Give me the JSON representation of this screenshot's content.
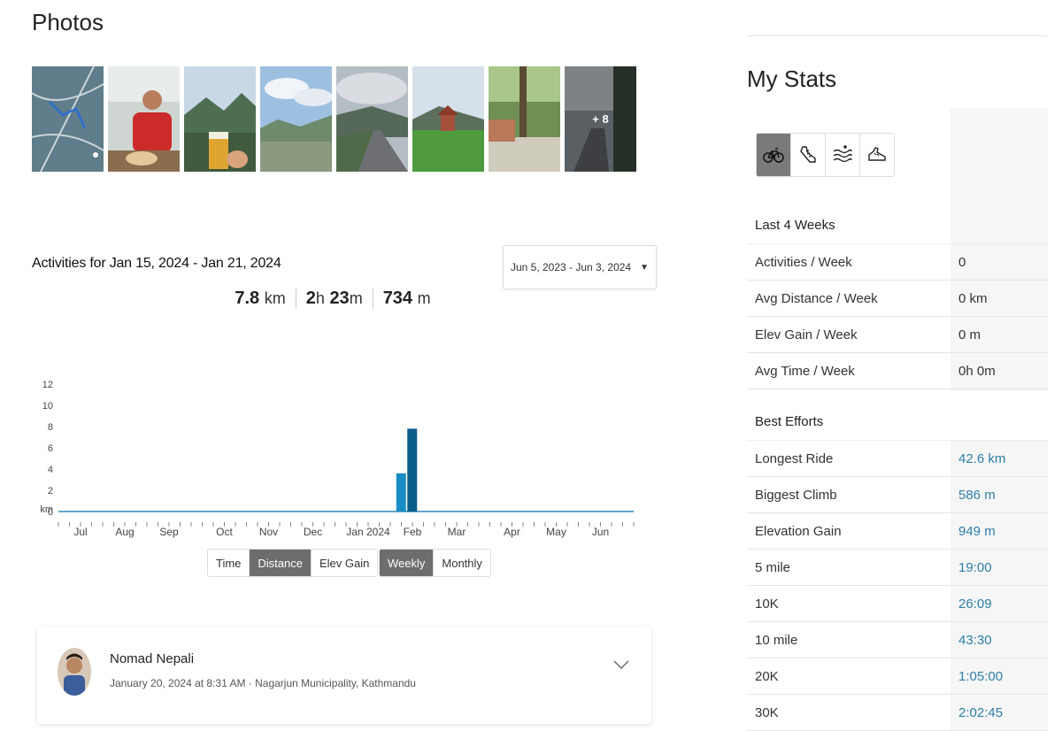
{
  "photos": {
    "title": "Photos",
    "more_label": "+ 8",
    "items": [
      {
        "name": "map"
      },
      {
        "name": "person-eating"
      },
      {
        "name": "beer-mountains"
      },
      {
        "name": "valley-view"
      },
      {
        "name": "road-clouds"
      },
      {
        "name": "pagoda-lawn"
      },
      {
        "name": "river-trees"
      },
      {
        "name": "road-more"
      }
    ]
  },
  "activities": {
    "title": "Activities for Jan 15, 2024 - Jan 21, 2024",
    "date_range": "Jun 5, 2023 - Jun 3, 2024",
    "summary": {
      "distance_value": "7.8",
      "distance_unit": "km",
      "hours_value": "2",
      "hours_unit": "h",
      "minutes_value": "23",
      "minutes_unit": "m",
      "elev_value": "734",
      "elev_unit": "m"
    }
  },
  "chart_data": {
    "type": "bar",
    "ylabel": "km",
    "y_ticks": [
      "12",
      "10",
      "8",
      "6",
      "4",
      "2",
      "0"
    ],
    "ylim": [
      0,
      12
    ],
    "months": [
      "Jul",
      "Aug",
      "Sep",
      "Oct",
      "Nov",
      "Dec",
      "Jan 2024",
      "Feb",
      "Mar",
      "Apr",
      "May",
      "Jun"
    ],
    "weeks_total": 53,
    "bars": [
      {
        "week_index": 31,
        "value": 3.6,
        "color": "#1a8ec4"
      },
      {
        "week_index": 32,
        "value": 7.8,
        "color": "#0b5c8a"
      }
    ],
    "baseline_color": "#2b86b8"
  },
  "metric_toggle": {
    "options": [
      "Time",
      "Distance",
      "Elev Gain"
    ],
    "active": "Distance"
  },
  "period_toggle": {
    "options": [
      "Weekly",
      "Monthly"
    ],
    "active": "Weekly"
  },
  "activity": {
    "athlete": "Nomad Nepali",
    "meta": "January 20, 2024 at 8:31 AM · Nagarjun Municipality, Kathmandu"
  },
  "stats": {
    "title": "My Stats",
    "sports": [
      {
        "name": "ride-icon",
        "active": true
      },
      {
        "name": "run-icon",
        "active": false
      },
      {
        "name": "swim-icon",
        "active": false
      },
      {
        "name": "walk-icon",
        "active": false
      }
    ],
    "last4_heading": "Last 4 Weeks",
    "last4": [
      {
        "label": "Activities / Week",
        "value": "0"
      },
      {
        "label": "Avg Distance / Week",
        "value": "0 km"
      },
      {
        "label": "Elev Gain / Week",
        "value": "0 m"
      },
      {
        "label": "Avg Time / Week",
        "value": "0h 0m"
      }
    ],
    "best_heading": "Best Efforts",
    "best": [
      {
        "label": "Longest Ride",
        "value": "42.6 km"
      },
      {
        "label": "Biggest Climb",
        "value": "586 m"
      },
      {
        "label": "Elevation Gain",
        "value": "949 m"
      },
      {
        "label": "5 mile",
        "value": "19:00"
      },
      {
        "label": "10K",
        "value": "26:09"
      },
      {
        "label": "10 mile",
        "value": "43:30"
      },
      {
        "label": "20K",
        "value": "1:05:00"
      },
      {
        "label": "30K",
        "value": "2:02:45"
      }
    ]
  }
}
